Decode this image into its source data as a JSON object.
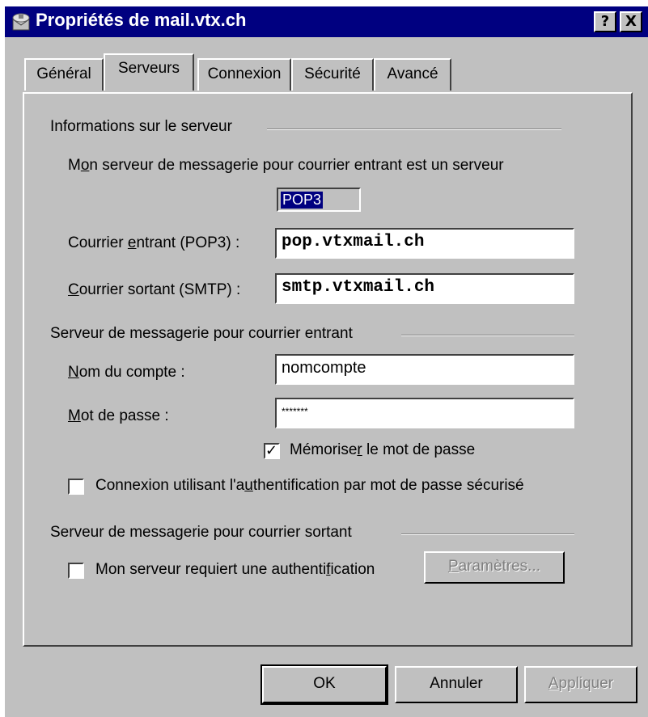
{
  "window": {
    "title": "Propriétés de mail.vtx.ch",
    "help_button": "?",
    "close_button": "X"
  },
  "tabs": [
    {
      "label": "Général"
    },
    {
      "label": "Serveurs"
    },
    {
      "label": "Connexion"
    },
    {
      "label": "Sécurité"
    },
    {
      "label": "Avancé"
    }
  ],
  "server_info": {
    "group_label": "Informations sur le serveur",
    "type_prefix": "M",
    "type_mnemonic": "o",
    "type_rest": "n serveur de messagerie pour courrier entrant est un serveur",
    "server_type": "POP3",
    "incoming_prefix": "Courrier ",
    "incoming_mnemonic": "e",
    "incoming_rest": "ntrant (POP3) :",
    "incoming_value": "pop.vtxmail.ch",
    "outgoing_mnemonic": "C",
    "outgoing_rest": "ourrier sortant (SMTP) :",
    "outgoing_value": "smtp.vtxmail.ch"
  },
  "incoming_server": {
    "group_label": "Serveur de messagerie pour courrier entrant",
    "account_mnemonic": "N",
    "account_rest": "om du compte :",
    "account_value": "nomcompte",
    "password_mnemonic": "M",
    "password_rest": "ot de passe :",
    "password_value": "*******",
    "remember_prefix": "Mémorise",
    "remember_mnemonic": "r",
    "remember_rest": " le mot de passe",
    "remember_checked": true,
    "spa_prefix": "Connexion utilisant l'a",
    "spa_mnemonic": "u",
    "spa_rest": "thentification par mot de passe sécurisé",
    "spa_checked": false
  },
  "outgoing_server": {
    "group_label": "Serveur de messagerie pour courrier sortant",
    "auth_prefix": "Mon serveur requiert une authenti",
    "auth_mnemonic": "f",
    "auth_rest": "ication",
    "auth_checked": false,
    "settings_mnemonic": "P",
    "settings_rest": "aramètres..."
  },
  "footer": {
    "ok_label": "OK",
    "cancel_label": "Annuler",
    "apply_mnemonic": "A",
    "apply_rest": "ppliquer"
  },
  "colors": {
    "titlebar": "#000080",
    "face": "#c0c0c0",
    "selection": "#000080"
  }
}
